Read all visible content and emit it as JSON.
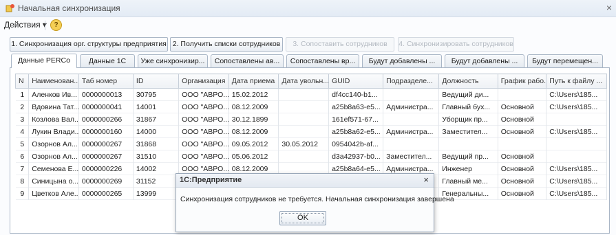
{
  "window": {
    "title": "Начальная синхронизация",
    "close_glyph": "×"
  },
  "menu": {
    "actions_label": "Действия ▾",
    "help_glyph": "?"
  },
  "steps": [
    {
      "label": "1. Синхронизация орг. структуры предприятия",
      "enabled": true
    },
    {
      "label": "2. Получить списки сотрудников",
      "enabled": true
    },
    {
      "label": "3. Сопоставить сотрудников",
      "enabled": false
    },
    {
      "label": "4. Синхронизировать сотрудников",
      "enabled": false
    }
  ],
  "tabs": [
    {
      "label": "Данные PERCo",
      "active": true
    },
    {
      "label": "Данные 1С",
      "active": false
    },
    {
      "label": "Уже синхронизир...",
      "active": false
    },
    {
      "label": "Сопоставлены ав...",
      "active": false
    },
    {
      "label": "Сопоставлены вр...",
      "active": false
    },
    {
      "label": "Будут добавлены ...",
      "active": false
    },
    {
      "label": "Будут добавлены ...",
      "active": false
    },
    {
      "label": "Будут перемещен...",
      "active": false
    }
  ],
  "table": {
    "columns": [
      "N",
      "Наименован...",
      "Таб номер",
      "ID",
      "Организация",
      "Дата приема",
      "Дата увольн...",
      "GUID",
      "Подразделе...",
      "Должность",
      "График рабо...",
      "Путь к файлу ..."
    ],
    "rows": [
      [
        "1",
        "Аленков Ив...",
        "0000000013",
        "30795",
        "ООО \"АВРО...",
        "15.02.2012",
        "",
        "df4cc140-b1...",
        "",
        "Ведущий ди...",
        "",
        "C:\\Users\\185..."
      ],
      [
        "2",
        "Вдовина Тат...",
        "0000000041",
        "14001",
        "ООО \"АВРО...",
        "08.12.2009",
        "",
        "a25b8a63-e5...",
        "Администра...",
        "Главный бух...",
        "Основной",
        "C:\\Users\\185..."
      ],
      [
        "3",
        "Козлова Вал...",
        "0000000266",
        "31867",
        "ООО \"АВРО...",
        "30.12.1899",
        "",
        "161ef571-67...",
        "",
        "Уборщик пр...",
        "Основной",
        ""
      ],
      [
        "4",
        "Лукин Влади...",
        "0000000160",
        "14000",
        "ООО \"АВРО...",
        "08.12.2009",
        "",
        "a25b8a62-e5...",
        "Администра...",
        "Заместител...",
        "Основной",
        "C:\\Users\\185..."
      ],
      [
        "5",
        "Озорнов Ал...",
        "0000000267",
        "31868",
        "ООО \"АВРО...",
        "09.05.2012",
        "30.05.2012",
        "0954042b-af...",
        "",
        "",
        "",
        ""
      ],
      [
        "6",
        "Озорнов Ал...",
        "0000000267",
        "31510",
        "ООО \"АВРО...",
        "05.06.2012",
        "",
        "d3a42937-b0...",
        "Заместител...",
        "Ведущий пр...",
        "Основной",
        ""
      ],
      [
        "7",
        "Семенова Е...",
        "0000000226",
        "14002",
        "ООО \"АВРО...",
        "08.12.2009",
        "",
        "a25b8a64-e5...",
        "Администра...",
        "Инженер",
        "Основной",
        "C:\\Users\\185..."
      ],
      [
        "8",
        "Синицына о...",
        "0000000269",
        "31152",
        "",
        "",
        "",
        "",
        "",
        "Главный ме...",
        "Основной",
        "C:\\Users\\185..."
      ],
      [
        "9",
        "Цветков Але...",
        "0000000265",
        "13999",
        "",
        "",
        "",
        "",
        "",
        "Генеральны...",
        "Основной",
        "C:\\Users\\185..."
      ]
    ]
  },
  "dialog": {
    "title": "1С:Предприятие",
    "close_glyph": "×",
    "message": "Синхронизация сотрудников не требуется. Начальная синхронизация завершена",
    "ok_label": "OK"
  },
  "icons": {
    "window_icon": "app-icon",
    "help_icon": "help-icon"
  }
}
